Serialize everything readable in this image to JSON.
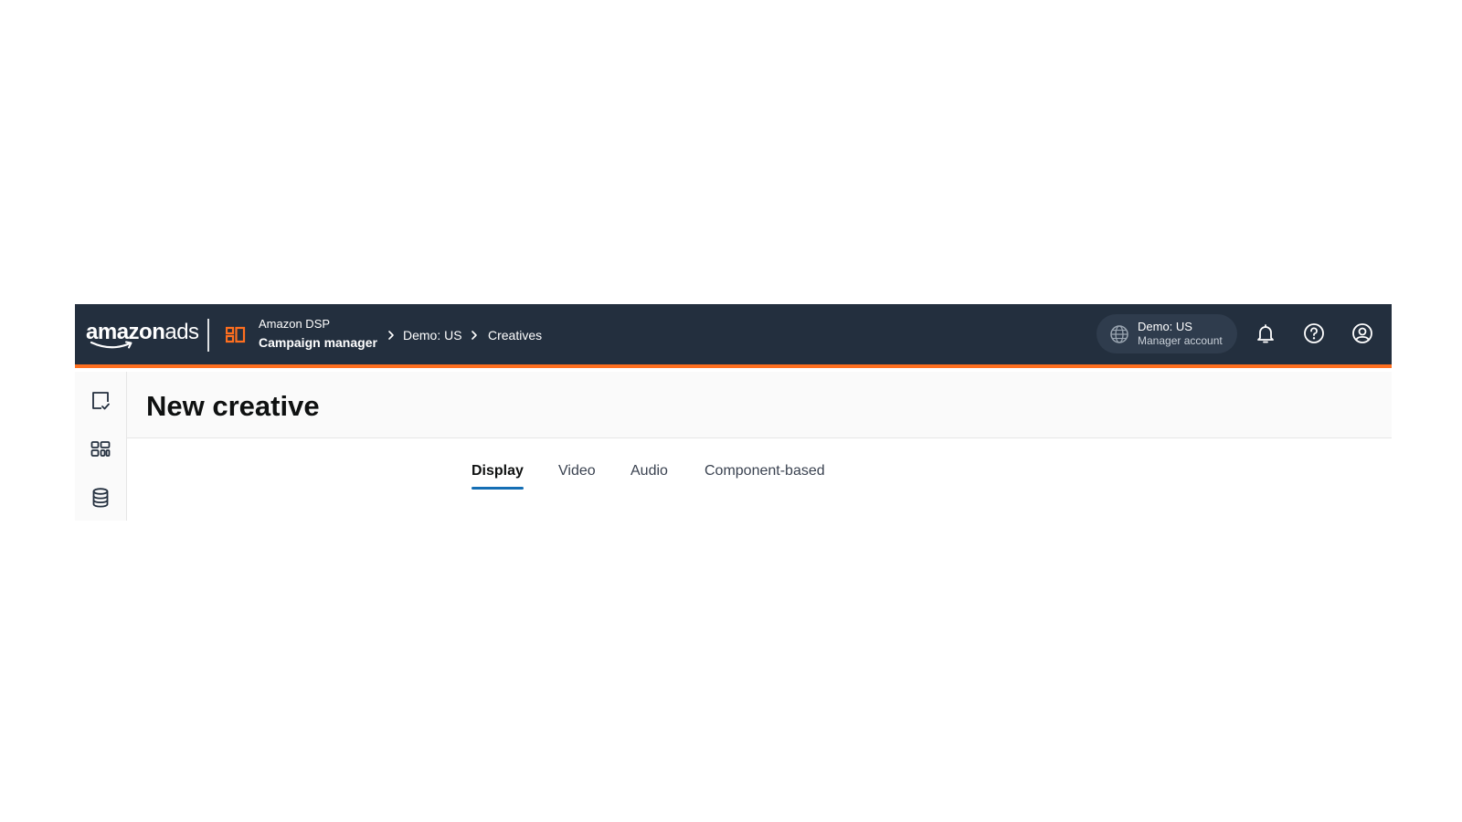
{
  "brand": {
    "logo_main": "amazon",
    "logo_suffix": "ads"
  },
  "app": {
    "subtitle": "Amazon DSP",
    "title": "Campaign manager"
  },
  "breadcrumb": [
    "Demo: US",
    "Creatives"
  ],
  "account": {
    "name": "Demo: US",
    "type": "Manager account"
  },
  "header_icons": [
    "bell-icon",
    "help-icon",
    "user-account-icon"
  ],
  "sidebar": {
    "items": [
      "checklist-icon",
      "apps-grid-icon",
      "database-icon"
    ]
  },
  "page": {
    "title": "New creative"
  },
  "tabs": [
    {
      "label": "Display",
      "active": true
    },
    {
      "label": "Video",
      "active": false
    },
    {
      "label": "Audio",
      "active": false
    },
    {
      "label": "Component-based",
      "active": false
    }
  ],
  "colors": {
    "topbar_bg": "#232f3e",
    "accent_orange": "#ff6f1f",
    "tab_active_underline": "#146eb4"
  }
}
